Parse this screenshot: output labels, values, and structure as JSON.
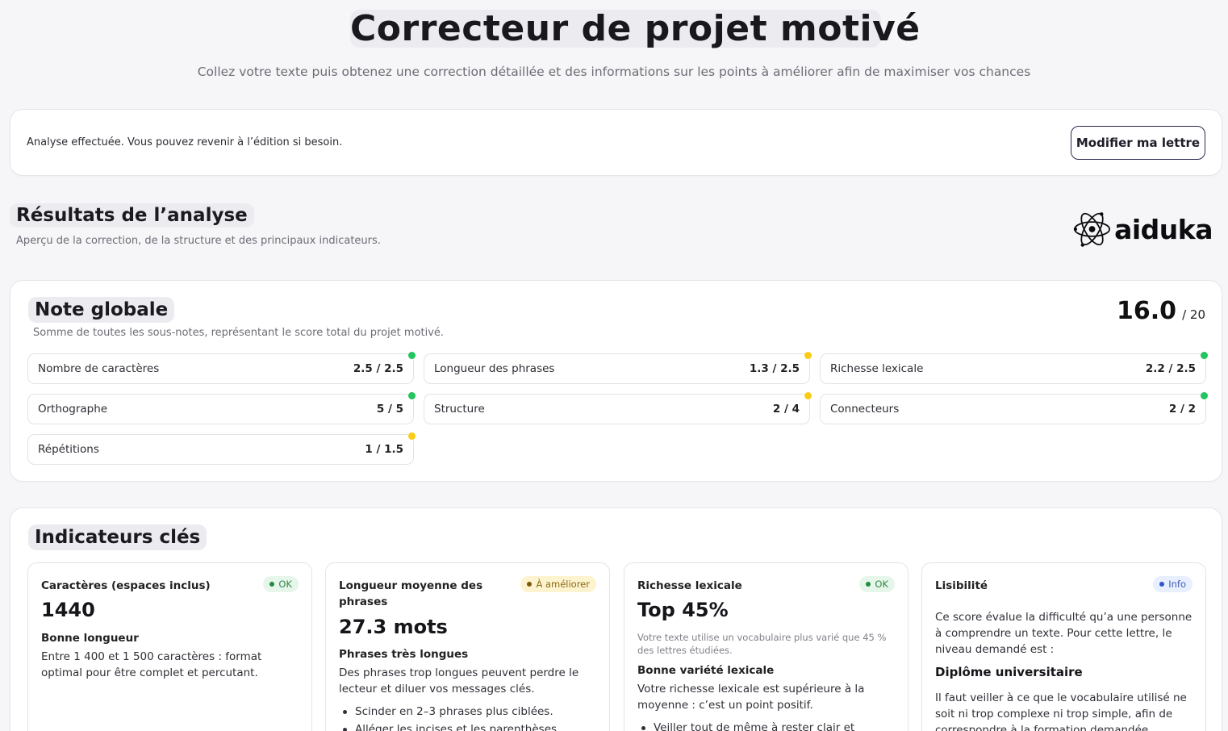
{
  "header": {
    "title": "Correcteur de projet motivé",
    "subtitle": "Collez votre texte puis obtenez une correction détaillée et des informations sur les points à améliorer afin de maximiser vos chances"
  },
  "status": {
    "message": "Analyse effectuée. Vous pouvez revenir à l’édition si besoin.",
    "edit_button": "Modifier ma lettre"
  },
  "results": {
    "title": "Résultats de l’analyse",
    "subtitle": "Aperçu de la correction, de la structure et des principaux indicateurs.",
    "logo_text": "aiduka",
    "logo_icon": "atom-icon"
  },
  "note": {
    "title": "Note globale",
    "subtitle": "Somme de toutes les sous-notes, représentant le score total du projet motivé.",
    "score": "16.0",
    "max": "/ 20",
    "items": [
      {
        "label": "Nombre de caractères",
        "value": "2.5 / 2.5",
        "status": "green"
      },
      {
        "label": "Longueur des phrases",
        "value": "1.3 / 2.5",
        "status": "yellow"
      },
      {
        "label": "Richesse lexicale",
        "value": "2.2 / 2.5",
        "status": "green"
      },
      {
        "label": "Orthographe",
        "value": "5 / 5",
        "status": "green"
      },
      {
        "label": "Structure",
        "value": "2 / 4",
        "status": "yellow"
      },
      {
        "label": "Connecteurs",
        "value": "2 / 2",
        "status": "green"
      },
      {
        "label": "Répétitions",
        "value": "1 / 1.5",
        "status": "yellow"
      }
    ]
  },
  "indicators": {
    "title": "Indicateurs clés",
    "cards": [
      {
        "title": "Caractères (espaces inclus)",
        "badge": "OK",
        "value": "1440",
        "subtitle": "Bonne longueur",
        "text": "Entre 1 400 et 1 500 caractères : format optimal pour être complet et percutant."
      },
      {
        "title": "Longueur moyenne des phrases",
        "badge": "À améliorer",
        "value": "27.3 mots",
        "subtitle": "Phrases très longues",
        "text": "Des phrases trop longues peuvent perdre le lecteur et diluer vos messages clés.",
        "bullets": [
          "Scinder en 2–3 phrases plus ciblées.",
          "Alléger les incises et les parenthèses."
        ]
      },
      {
        "title": "Richesse lexicale",
        "badge": "OK",
        "value": "Top 45%",
        "note": "Votre texte utilise un vocabulaire plus varié que 45 % des lettres étudiées.",
        "subtitle": "Bonne variété lexicale",
        "text": "Votre richesse lexicale est supérieure à la moyenne : c’est un point positif.",
        "bullets": [
          "Veiller tout de même à rester clair et"
        ]
      },
      {
        "title": "Lisibilité",
        "badge": "Info",
        "text": "Ce score évalue la difficulté qu’a une personne à comprendre un texte. Pour cette lettre, le niveau demandé est :",
        "level": "Diplôme universitaire",
        "text2": "Il faut veiller à ce que le vocabulaire utilisé ne soit ni trop complexe ni trop simple, afin de correspondre à la formation demandée."
      }
    ]
  },
  "colors": {
    "green": "#22c55e",
    "yellow": "#facc15",
    "accent_border": "#2a2a52"
  }
}
